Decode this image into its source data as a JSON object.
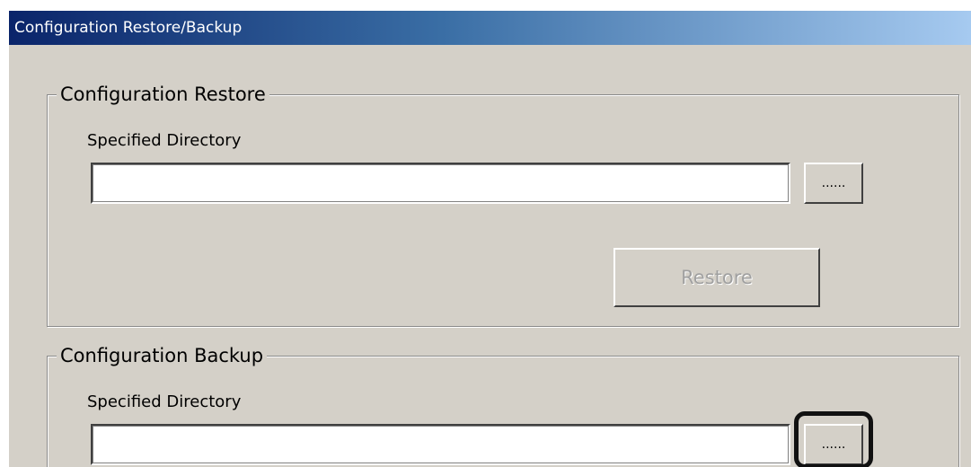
{
  "window": {
    "title": "Configuration Restore/Backup"
  },
  "restore_group": {
    "legend": "Configuration Restore",
    "directory_label": "Specified Directory",
    "directory_value": "",
    "browse_label": "......",
    "restore_label": "Restore",
    "restore_enabled": false
  },
  "backup_group": {
    "legend": "Configuration Backup",
    "directory_label": "Specified Directory",
    "directory_value": "",
    "browse_label": "......"
  },
  "colors": {
    "dialog_bg": "#d4d0c8",
    "titlebar_start": "#0a246a",
    "titlebar_end": "#a6caf0",
    "highlight": "#111111"
  }
}
